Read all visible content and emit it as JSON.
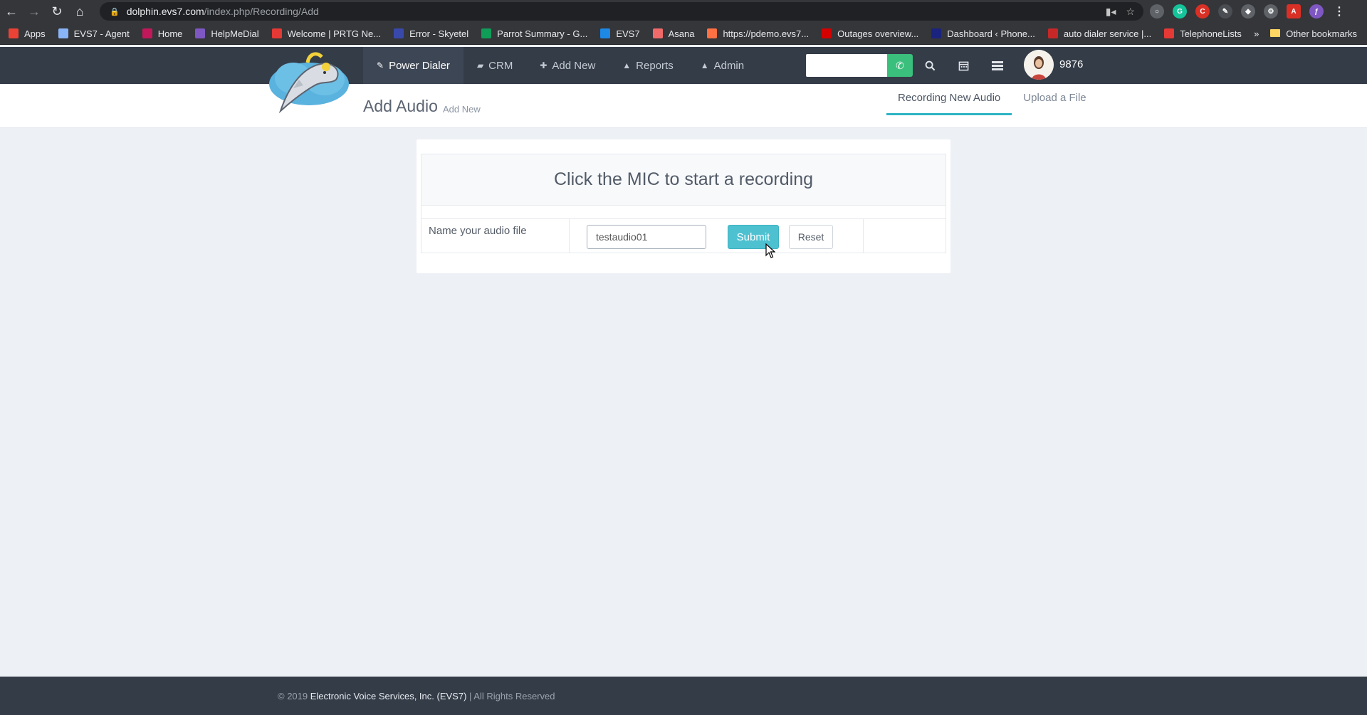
{
  "browser": {
    "url_host": "dolphin.evs7.com",
    "url_path": "/index.php/Recording/Add",
    "bookmarks": [
      {
        "label": "Apps",
        "color": "#ea4335"
      },
      {
        "label": "EVS7 - Agent",
        "color": "#8ab4f8"
      },
      {
        "label": "Home",
        "color": "#c2185b"
      },
      {
        "label": "HelpMeDial",
        "color": "#7e57c2"
      },
      {
        "label": "Welcome | PRTG Ne...",
        "color": "#e53935"
      },
      {
        "label": "Error - Skyetel",
        "color": "#3949ab"
      },
      {
        "label": "Parrot Summary - G...",
        "color": "#0f9d58"
      },
      {
        "label": "EVS7",
        "color": "#1e88e5"
      },
      {
        "label": "Asana",
        "color": "#f06a6a"
      },
      {
        "label": "https://pdemo.evs7...",
        "color": "#ff7043"
      },
      {
        "label": "Outages overview...",
        "color": "#d50000"
      },
      {
        "label": "Dashboard ‹ Phone...",
        "color": "#1a237e"
      },
      {
        "label": "auto dialer service |...",
        "color": "#c62828"
      },
      {
        "label": "TelephoneLists",
        "color": "#e53935"
      }
    ],
    "more_label": "»",
    "other_bookmarks": "Other bookmarks"
  },
  "nav": {
    "items": [
      {
        "label": "Power Dialer",
        "icon": "✎"
      },
      {
        "label": "CRM",
        "icon": "▰"
      },
      {
        "label": "Add New",
        "icon": "✚"
      },
      {
        "label": "Reports",
        "icon": "▲"
      },
      {
        "label": "Admin",
        "icon": "▲"
      }
    ],
    "extension": "9876"
  },
  "header": {
    "title": "Add Audio",
    "subtitle": "Add New",
    "tabs": [
      {
        "label": "Recording New Audio"
      },
      {
        "label": "Upload a File"
      }
    ]
  },
  "form": {
    "heading": "Click the MIC to start a recording",
    "name_label": "Name your audio file",
    "name_value": "testaudio01",
    "submit_label": "Submit",
    "reset_label": "Reset"
  },
  "footer": {
    "prefix": "© 2019",
    "company": "Electronic Voice Services, Inc. (EVS7)",
    "suffix": "| All Rights Reserved"
  }
}
